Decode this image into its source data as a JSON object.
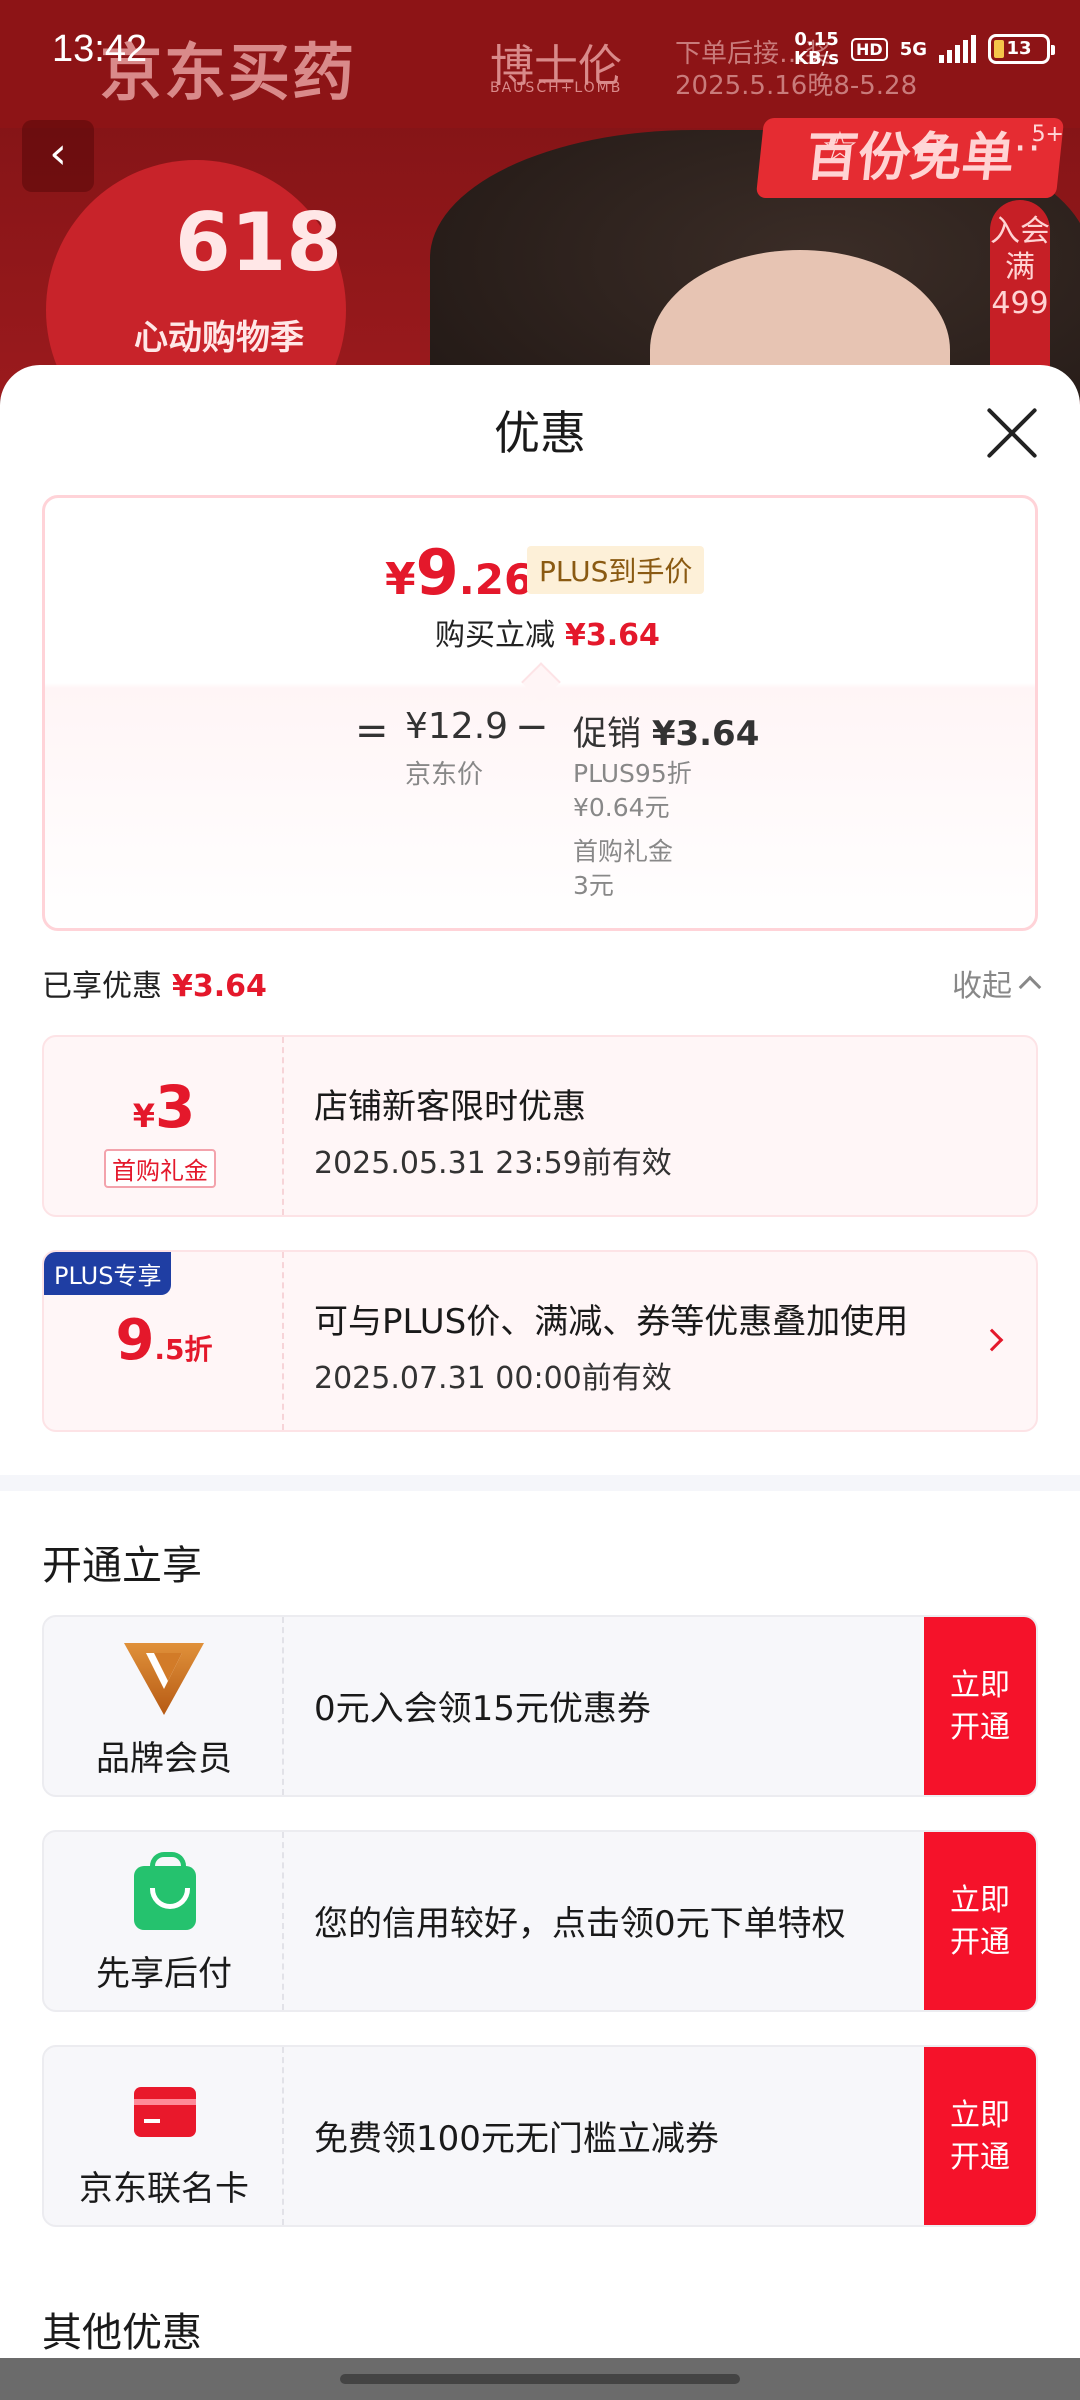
{
  "status_bar": {
    "time": "13:42",
    "net_speed": "0.15\nKB/s",
    "hd": "HD",
    "network": "5G",
    "battery": "13"
  },
  "banner": {
    "brand": "京东买药",
    "partner": "博士伦",
    "partner_en": "BAUSCH+LOMB",
    "promo_text": "下单后接…奖\n2025.5.16晚8-5.28",
    "badge_618": "618",
    "badge_618_sub": "心动购物季",
    "promo_tag": "百份免单",
    "side_tag": "入会满499",
    "more_count": "5+"
  },
  "sheet": {
    "title": "优惠",
    "price_summary": {
      "yen": "¥",
      "price_int": "9",
      "price_dec": ".26",
      "plus_tag": "PLUS到手价",
      "reduce_label": "购买立减",
      "reduce_value": "¥3.64",
      "equals": "=",
      "base_price": "¥12.9",
      "base_label": "京东价",
      "minus": "−",
      "promo_label": "促销",
      "promo_value": "¥3.64",
      "details": [
        "PLUS95折",
        "¥0.64元",
        "首购礼金",
        "3元"
      ]
    },
    "enjoyed_label": "已享优惠",
    "enjoyed_value": "¥3.64",
    "collapse_label": "收起",
    "coupons": [
      {
        "yen": "¥",
        "amount": "3",
        "tag": "首购礼金",
        "title": "店铺新客限时优惠",
        "validity": "2025.05.31 23:59前有效"
      },
      {
        "badge": "PLUS专享",
        "amount": "9",
        "amount_suffix": ".5折",
        "title": "可与PLUS价、满减、券等优惠叠加使用",
        "validity": "2025.07.31 00:00前有效"
      }
    ],
    "open_section_title": "开通立享",
    "benefits": [
      {
        "icon": "brand-member-icon",
        "label": "品牌会员",
        "text": "0元入会领15元优惠券",
        "button": "立即\n开通"
      },
      {
        "icon": "shopping-bag-icon",
        "label": "先享后付",
        "text": "您的信用较好，点击领0元下单特权",
        "button": "立即\n开通"
      },
      {
        "icon": "credit-card-icon",
        "label": "京东联名卡",
        "text": "免费领100元无门槛立减券",
        "button": "立即\n开通"
      }
    ],
    "other_section_title": "其他优惠"
  },
  "colors": {
    "accent_red": "#e4182b",
    "button_red": "#f5122a",
    "plus_blue": "#1f3ea3"
  }
}
